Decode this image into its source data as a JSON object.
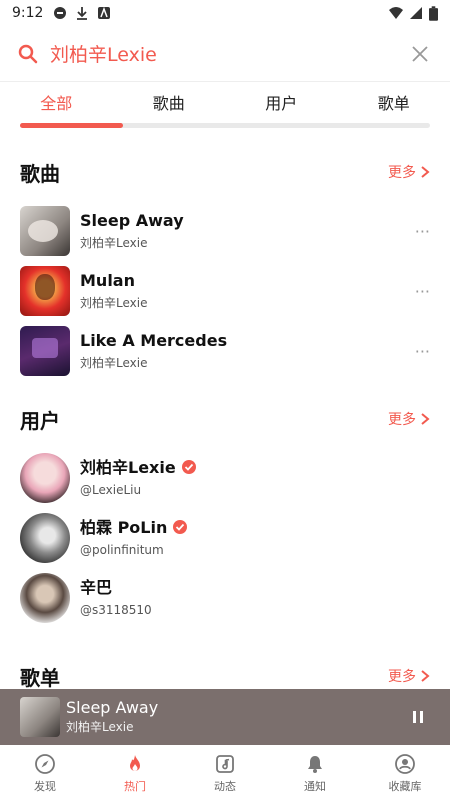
{
  "status_bar": {
    "time": "9:12"
  },
  "search": {
    "query": "刘柏辛Lexie"
  },
  "tabs": [
    {
      "label": "全部",
      "active": true
    },
    {
      "label": "歌曲",
      "active": false
    },
    {
      "label": "用户",
      "active": false
    },
    {
      "label": "歌单",
      "active": false
    }
  ],
  "songs_section": {
    "title": "歌曲",
    "more_label": "更多",
    "items": [
      {
        "title": "Sleep Away",
        "artist": "刘柏辛Lexie"
      },
      {
        "title": "Mulan",
        "artist": "刘柏辛Lexie"
      },
      {
        "title": "Like A Mercedes",
        "artist": "刘柏辛Lexie"
      }
    ]
  },
  "users_section": {
    "title": "用户",
    "more_label": "更多",
    "items": [
      {
        "name": "刘柏辛Lexie",
        "handle": "@LexieLiu",
        "verified": true
      },
      {
        "name": "柏霖 PoLin",
        "handle": "@polinfinitum",
        "verified": true
      },
      {
        "name": "辛巴",
        "handle": "@s3118510",
        "verified": false
      }
    ]
  },
  "playlists_section": {
    "title": "歌单",
    "more_label": "更多"
  },
  "player": {
    "title": "Sleep Away",
    "artist": "刘柏辛Lexie"
  },
  "bottom_nav": [
    {
      "label": "发现",
      "icon": "compass-icon",
      "active": false
    },
    {
      "label": "热门",
      "icon": "flame-icon",
      "active": true
    },
    {
      "label": "动态",
      "icon": "music-note-icon",
      "active": false
    },
    {
      "label": "通知",
      "icon": "bell-icon",
      "active": false
    },
    {
      "label": "收藏库",
      "icon": "profile-icon",
      "active": false
    }
  ],
  "colors": {
    "accent": "#f25a4f",
    "player_bg": "#7b6f6d"
  }
}
